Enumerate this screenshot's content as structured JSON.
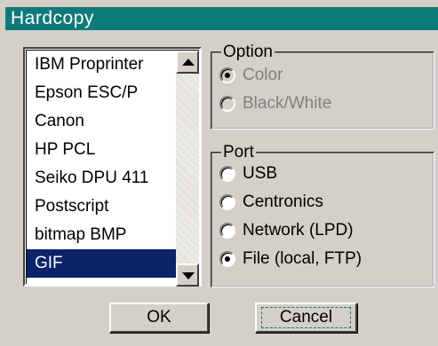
{
  "window": {
    "title": "Hardcopy"
  },
  "printers": {
    "items": [
      "IBM Proprinter",
      "Epson ESC/P",
      "Canon",
      "HP PCL",
      "Seiko DPU 411",
      "Postscript",
      "bitmap BMP",
      "GIF"
    ],
    "selected_index": 7
  },
  "option": {
    "label": "Option",
    "choices": [
      {
        "label": "Color",
        "checked": true,
        "enabled": false
      },
      {
        "label": "Black/White",
        "checked": false,
        "enabled": false
      }
    ]
  },
  "port": {
    "label": "Port",
    "choices": [
      {
        "label": "USB",
        "checked": false,
        "enabled": true
      },
      {
        "label": "Centronics",
        "checked": false,
        "enabled": true
      },
      {
        "label": "Network (LPD)",
        "checked": false,
        "enabled": true
      },
      {
        "label": "File (local, FTP)",
        "checked": true,
        "enabled": true
      }
    ]
  },
  "buttons": {
    "ok": "OK",
    "cancel": "Cancel"
  },
  "colors": {
    "title_bar": "#0f7a7a",
    "selection": "#0a246a",
    "face": "#d4d0c8"
  },
  "icons": {
    "scroll_up": "arrow-up-icon",
    "scroll_down": "arrow-down-icon"
  }
}
